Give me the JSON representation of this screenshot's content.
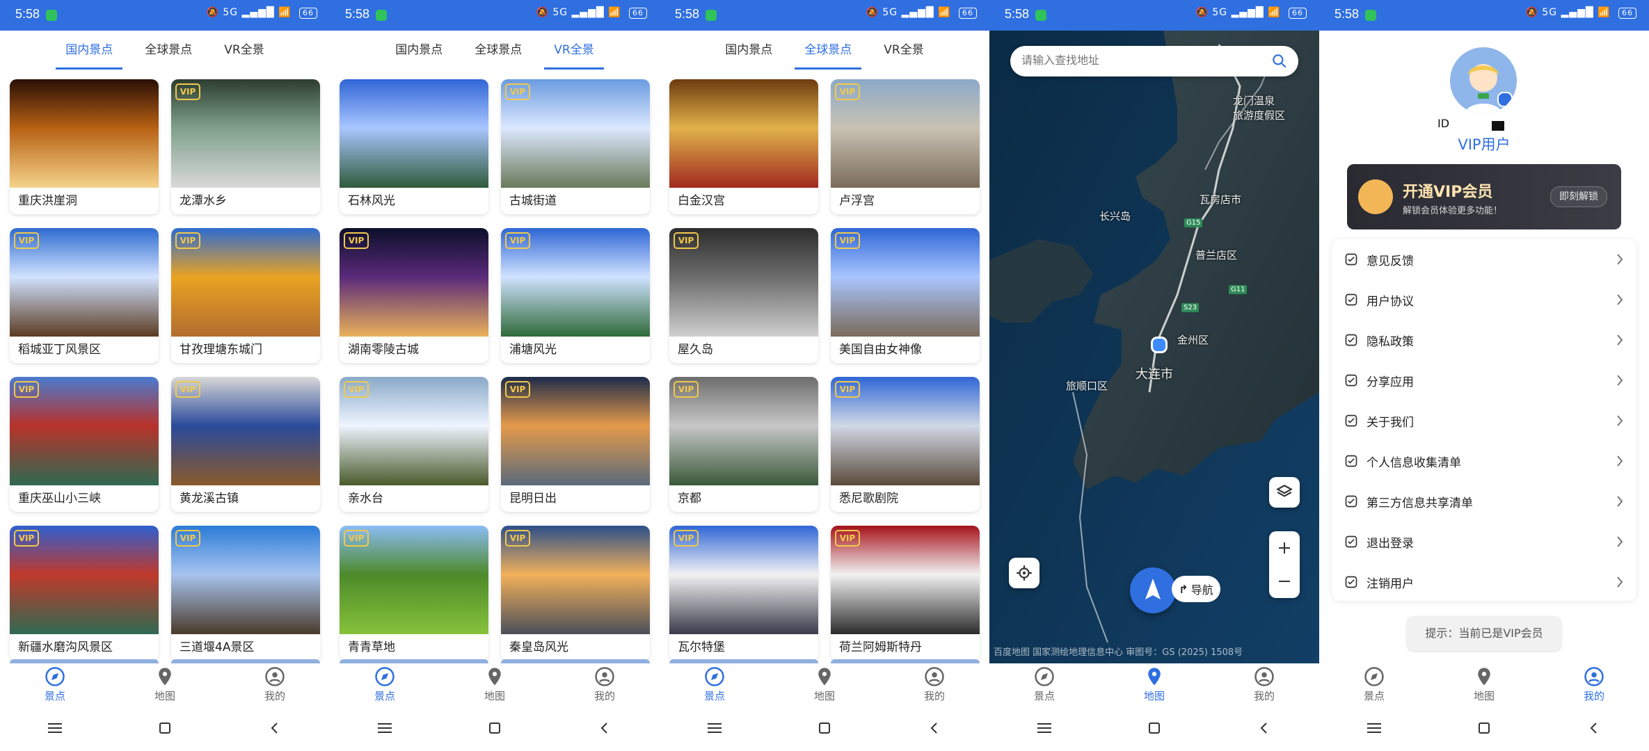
{
  "status": {
    "time": "5:58",
    "battery": "66",
    "network": "5G"
  },
  "nav": {
    "scenic": "景点",
    "map": "地图",
    "mine": "我的"
  },
  "tabs": {
    "domestic": "国内景点",
    "global": "全球景点",
    "vr": "VR全景"
  },
  "screen1": {
    "cards": [
      {
        "title": "重庆洪崖洞",
        "vip": false,
        "colors": [
          "#2a0f06",
          "#b76113",
          "#f5d38a"
        ]
      },
      {
        "title": "龙潭水乡",
        "vip": true,
        "colors": [
          "#2c3d2f",
          "#7fa08c",
          "#d9d9d9"
        ]
      },
      {
        "title": "稻城亚丁风景区",
        "vip": true,
        "colors": [
          "#2e6bd0",
          "#d1e2ff",
          "#5b3b22"
        ]
      },
      {
        "title": "甘孜理塘东城门",
        "vip": true,
        "colors": [
          "#2e6bd0",
          "#e9a322",
          "#b26d2e"
        ]
      },
      {
        "title": "重庆巫山小三峡",
        "vip": true,
        "colors": [
          "#4a7bd0",
          "#b8322a",
          "#2f6a52"
        ]
      },
      {
        "title": "黄龙溪古镇",
        "vip": true,
        "colors": [
          "#d8d8d8",
          "#2a4a9b",
          "#8a5a2a"
        ]
      },
      {
        "title": "新疆水磨沟风景区",
        "vip": true,
        "colors": [
          "#2f5fd0",
          "#c0392b",
          "#2f6a52"
        ]
      },
      {
        "title": "三道堰4A景区",
        "vip": true,
        "colors": [
          "#2b7bd8",
          "#a7c4ef",
          "#4a3a2a"
        ]
      }
    ]
  },
  "screen2": {
    "cards": [
      {
        "title": "石林风光",
        "vip": false,
        "colors": [
          "#2f66d6",
          "#a9c6ff",
          "#2f5a3a"
        ]
      },
      {
        "title": "古城街道",
        "vip": true,
        "colors": [
          "#6a9be0",
          "#dce8ff",
          "#6a7a5a"
        ]
      },
      {
        "title": "湖南零陵古城",
        "vip": true,
        "colors": [
          "#0b0f2a",
          "#5a2a7a",
          "#e9b15a"
        ]
      },
      {
        "title": "浦塘风光",
        "vip": true,
        "colors": [
          "#2f66d6",
          "#cfe2ff",
          "#2f6a3a"
        ]
      },
      {
        "title": "亲水台",
        "vip": true,
        "colors": [
          "#8aa9c8",
          "#eef4ff",
          "#4b5a2a"
        ]
      },
      {
        "title": "昆明日出",
        "vip": true,
        "colors": [
          "#1d2b4a",
          "#e59a4b",
          "#5a6a7a"
        ]
      },
      {
        "title": "青青草地",
        "vip": true,
        "colors": [
          "#8bbcf5",
          "#4d8a2a",
          "#86c23a"
        ]
      },
      {
        "title": "秦皇岛风光",
        "vip": true,
        "colors": [
          "#2c4f8a",
          "#f2b05a",
          "#4b4f5a"
        ]
      }
    ]
  },
  "screen3": {
    "cards": [
      {
        "title": "白金汉宫",
        "vip": false,
        "colors": [
          "#6e3b0f",
          "#e0b24b",
          "#a12a20"
        ]
      },
      {
        "title": "卢浮宫",
        "vip": true,
        "colors": [
          "#8aa9c8",
          "#c9c2b3",
          "#7a6b5a"
        ]
      },
      {
        "title": "屋久岛",
        "vip": true,
        "colors": [
          "#2d2d2d",
          "#6c6c6c",
          "#cfcfcf"
        ]
      },
      {
        "title": "美国自由女神像",
        "vip": true,
        "colors": [
          "#2f66d6",
          "#a9c6ff",
          "#7a6b5a"
        ]
      },
      {
        "title": "京都",
        "vip": true,
        "colors": [
          "#6d6d6d",
          "#c7c7c7",
          "#3a5a3a"
        ]
      },
      {
        "title": "悉尼歌剧院",
        "vip": true,
        "colors": [
          "#2f66d6",
          "#d0d8e6",
          "#5a4a3a"
        ]
      },
      {
        "title": "瓦尔特堡",
        "vip": true,
        "colors": [
          "#2f66d6",
          "#f2f2f2",
          "#3a3a4a"
        ]
      },
      {
        "title": "荷兰阿姆斯特丹",
        "vip": true,
        "colors": [
          "#a5121a",
          "#f2f2f2",
          "#2b2b2b"
        ]
      }
    ]
  },
  "map": {
    "search_placeholder": "请输入查找地址",
    "labels": {
      "a": "龙门温泉\n旅游度假区",
      "b": "长兴岛",
      "c": "瓦房店市",
      "d": "普兰店区",
      "e": "金州区",
      "f": "大连市",
      "g": "旅顺口区"
    },
    "badges": {
      "g15": "G15",
      "s23": "S23",
      "g11": "G11"
    },
    "navigate_label": "导航",
    "footer": "百度地图 国家测绘地理信息中心 审图号：GS (2025) 1508号"
  },
  "profile": {
    "id_label": "ID",
    "user_type": "VIP用户",
    "vip_banner_title": "开通VIP会员",
    "vip_banner_subtitle": "解锁会员体验更多功能！",
    "vip_banner_button": "即刻解锁",
    "menu": [
      "意见反馈",
      "用户协议",
      "隐私政策",
      "分享应用",
      "关于我们",
      "个人信息收集清单",
      "第三方信息共享清单",
      "退出登录",
      "注销用户"
    ],
    "toast": "提示：当前已是VIP会员"
  },
  "vip_text": "VIP",
  "colors": {
    "primary": "#2f6fe0",
    "gold": "#f2c94c"
  }
}
